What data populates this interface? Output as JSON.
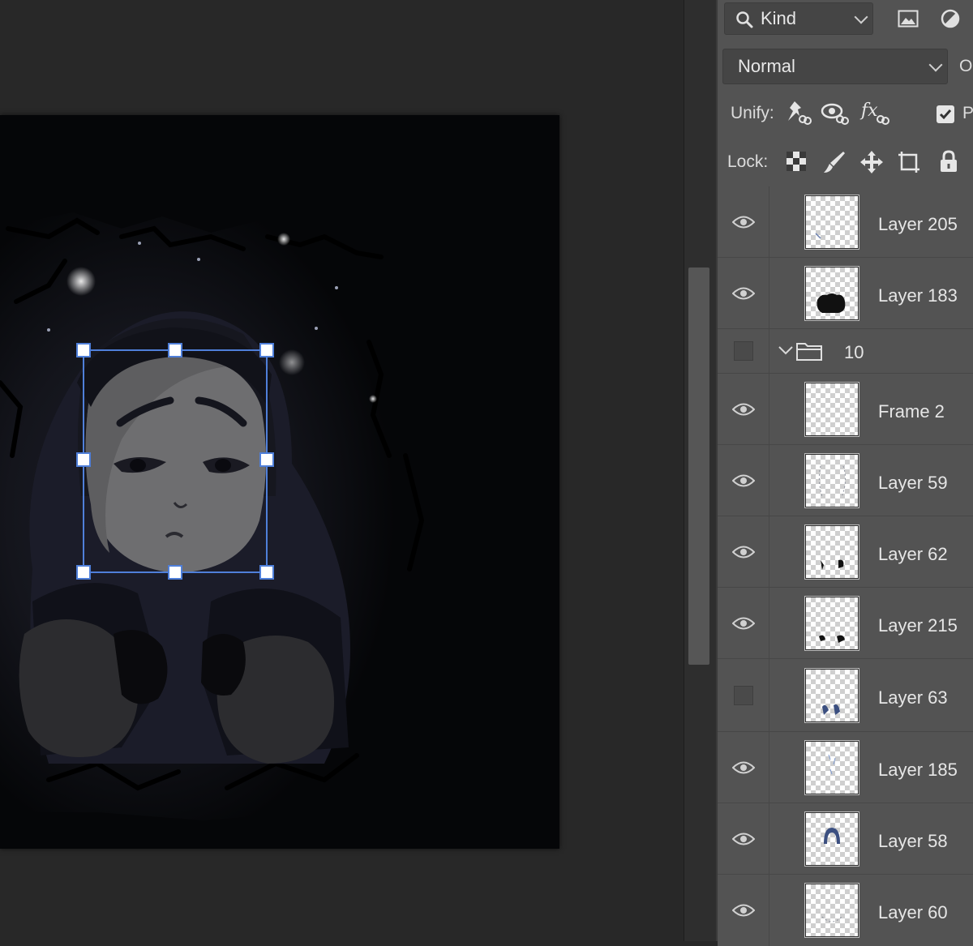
{
  "layers_panel": {
    "filter": {
      "label": "Kind"
    },
    "blend_mode": {
      "value": "Normal"
    },
    "opacity_label_partial": "O",
    "unify": {
      "label": "Unify:"
    },
    "propagate_partial": "P",
    "lock": {
      "label": "Lock:"
    },
    "layers": [
      {
        "name": "Layer 205",
        "visible": true
      },
      {
        "name": "Layer 183",
        "visible": true
      },
      {
        "name": "10",
        "type": "group",
        "expanded": true,
        "visible": false
      },
      {
        "name": "Frame 2",
        "visible": true
      },
      {
        "name": "Layer 59",
        "visible": true
      },
      {
        "name": "Layer 62",
        "visible": true
      },
      {
        "name": "Layer 215",
        "visible": true
      },
      {
        "name": "Layer 63",
        "visible": false
      },
      {
        "name": "Layer 185",
        "visible": true
      },
      {
        "name": "Layer 58",
        "visible": true
      },
      {
        "name": "Layer 60",
        "visible": true
      }
    ]
  },
  "colors": {
    "panel_bg": "#535353",
    "workspace_bg": "#282828",
    "canvas_bg": "#050608",
    "transform_accent": "#4f7fd9"
  }
}
